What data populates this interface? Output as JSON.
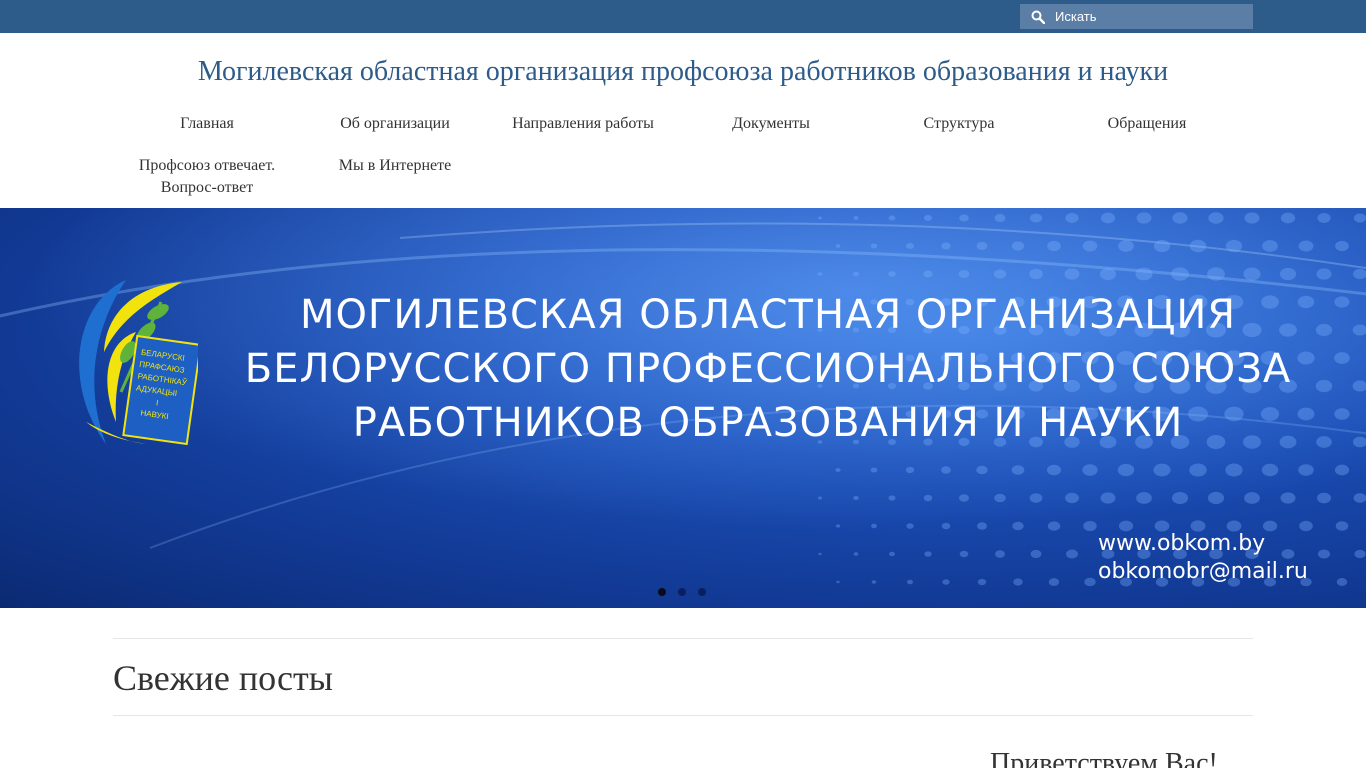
{
  "search": {
    "placeholder": "Искать"
  },
  "header": {
    "title": "Могилевская областная организация профсоюза работников образования и науки"
  },
  "nav": {
    "items": [
      {
        "label": "Главная"
      },
      {
        "label": "Об организации"
      },
      {
        "label": "Направления работы"
      },
      {
        "label": "Документы"
      },
      {
        "label": "Структура"
      },
      {
        "label": "Обращения"
      },
      {
        "label": "Профсоюз отвечает. Вопрос-ответ"
      },
      {
        "label": "Мы в Интернете"
      }
    ]
  },
  "banner": {
    "line1": "МОГИЛЕВСКАЯ ОБЛАСТНАЯ ОРГАНИЗАЦИЯ",
    "line2": "БЕЛОРУССКОГО ПРОФЕССИОНАЛЬНОГО СОЮЗА",
    "line3": "РАБОТНИКОВ ОБРАЗОВАНИЯ И НАУКИ",
    "website": "www.obkom.by",
    "email": "obkomobr@mail.ru",
    "logo_text": "БЕЛАРУСКІ ПРАФСАЮЗ РАБОТНІКАЎ АДУКАЦЫІ І НАВУКІ",
    "slide_count": 3,
    "active_slide": 1
  },
  "content": {
    "section_title": "Свежие посты",
    "greeting": "Приветствуем Вас!"
  },
  "colors": {
    "topbar": "#2e5c8a",
    "search_bg": "#5a7ea6",
    "title": "#2e5c8a",
    "banner_blue": "#1b4fb8",
    "logo_yellow": "#f2e30f",
    "logo_green": "#5fb33a"
  }
}
